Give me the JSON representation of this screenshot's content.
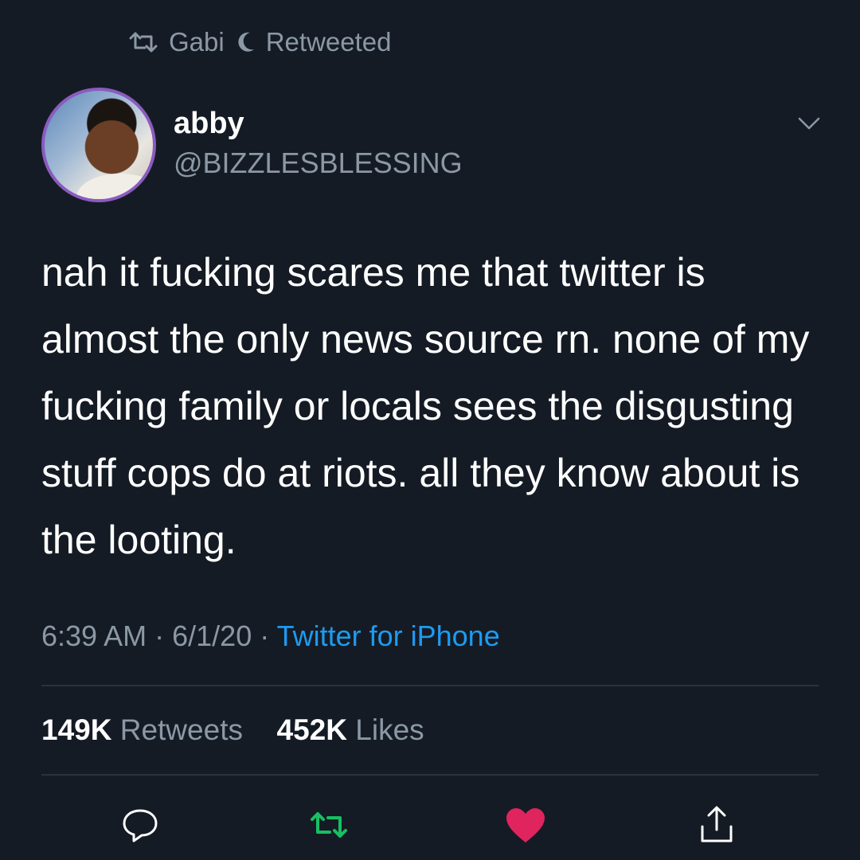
{
  "retweet_context": {
    "icon": "retweet-icon",
    "user": "Gabi",
    "moon_icon": "moon-icon",
    "label": "Retweeted"
  },
  "author": {
    "display_name": "abby",
    "handle": "@BIZZLESBLESSING",
    "avatar_icon": "avatar"
  },
  "tweet": {
    "text": "nah it fucking scares me that twitter is almost the only news source rn. none of my fucking family or locals sees the disgusting stuff cops do at riots. all they know about is the looting."
  },
  "meta": {
    "time": "6:39 AM",
    "separator": "·",
    "date": "6/1/20",
    "source": "Twitter for iPhone"
  },
  "stats": {
    "retweets_count": "149K",
    "retweets_label": "Retweets",
    "likes_count": "452K",
    "likes_label": "Likes"
  },
  "actions": [
    "reply-icon",
    "retweet-icon",
    "heart-icon",
    "share-icon"
  ],
  "colors": {
    "background": "#151b24",
    "secondary_text": "#8b98a5",
    "link": "#1d9bf0",
    "retweet_green": "#17bf63",
    "like_pink": "#e0245e"
  }
}
